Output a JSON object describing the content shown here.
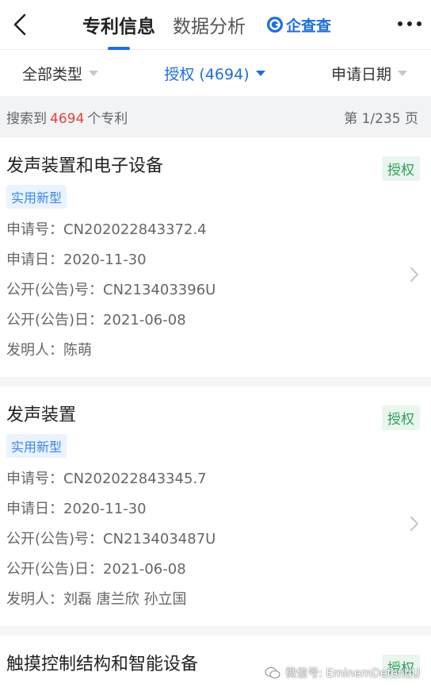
{
  "header": {
    "tabs": [
      "专利信息",
      "数据分析"
    ],
    "brand": "企查查"
  },
  "filters": [
    {
      "label": "全部类型"
    },
    {
      "label": "授权 (4694)"
    },
    {
      "label": "申请日期"
    }
  ],
  "summary": {
    "prefix": "搜索到",
    "count": "4694",
    "suffix": "个专利",
    "page": "第 1/235 页"
  },
  "patents": [
    {
      "title": "发声装置和电子设备",
      "status": "授权",
      "type": "实用新型",
      "fields": [
        {
          "label": "申请号：",
          "value": "CN202022843372.4"
        },
        {
          "label": "申请日：",
          "value": "2020-11-30"
        },
        {
          "label": "公开(公告)号：",
          "value": "CN213403396U"
        },
        {
          "label": "公开(公告)日：",
          "value": "2021-06-08"
        },
        {
          "label": "发明人：",
          "value": "陈萌"
        }
      ]
    },
    {
      "title": "发声装置",
      "status": "授权",
      "type": "实用新型",
      "fields": [
        {
          "label": "申请号：",
          "value": "CN202022843345.7"
        },
        {
          "label": "申请日：",
          "value": "2020-11-30"
        },
        {
          "label": "公开(公告)号：",
          "value": "CN213403487U"
        },
        {
          "label": "公开(公告)日：",
          "value": "2021-06-08"
        },
        {
          "label": "发明人：",
          "value": "刘磊  唐兰欣  孙立国"
        }
      ]
    },
    {
      "title": "触摸控制结构和智能设备",
      "status": "授权"
    }
  ],
  "watermark": "微信号: EminemDefendU",
  "colors": {
    "accent": "#1e6fdc",
    "count": "#e0443e",
    "status_green": "#2f9e5b"
  }
}
